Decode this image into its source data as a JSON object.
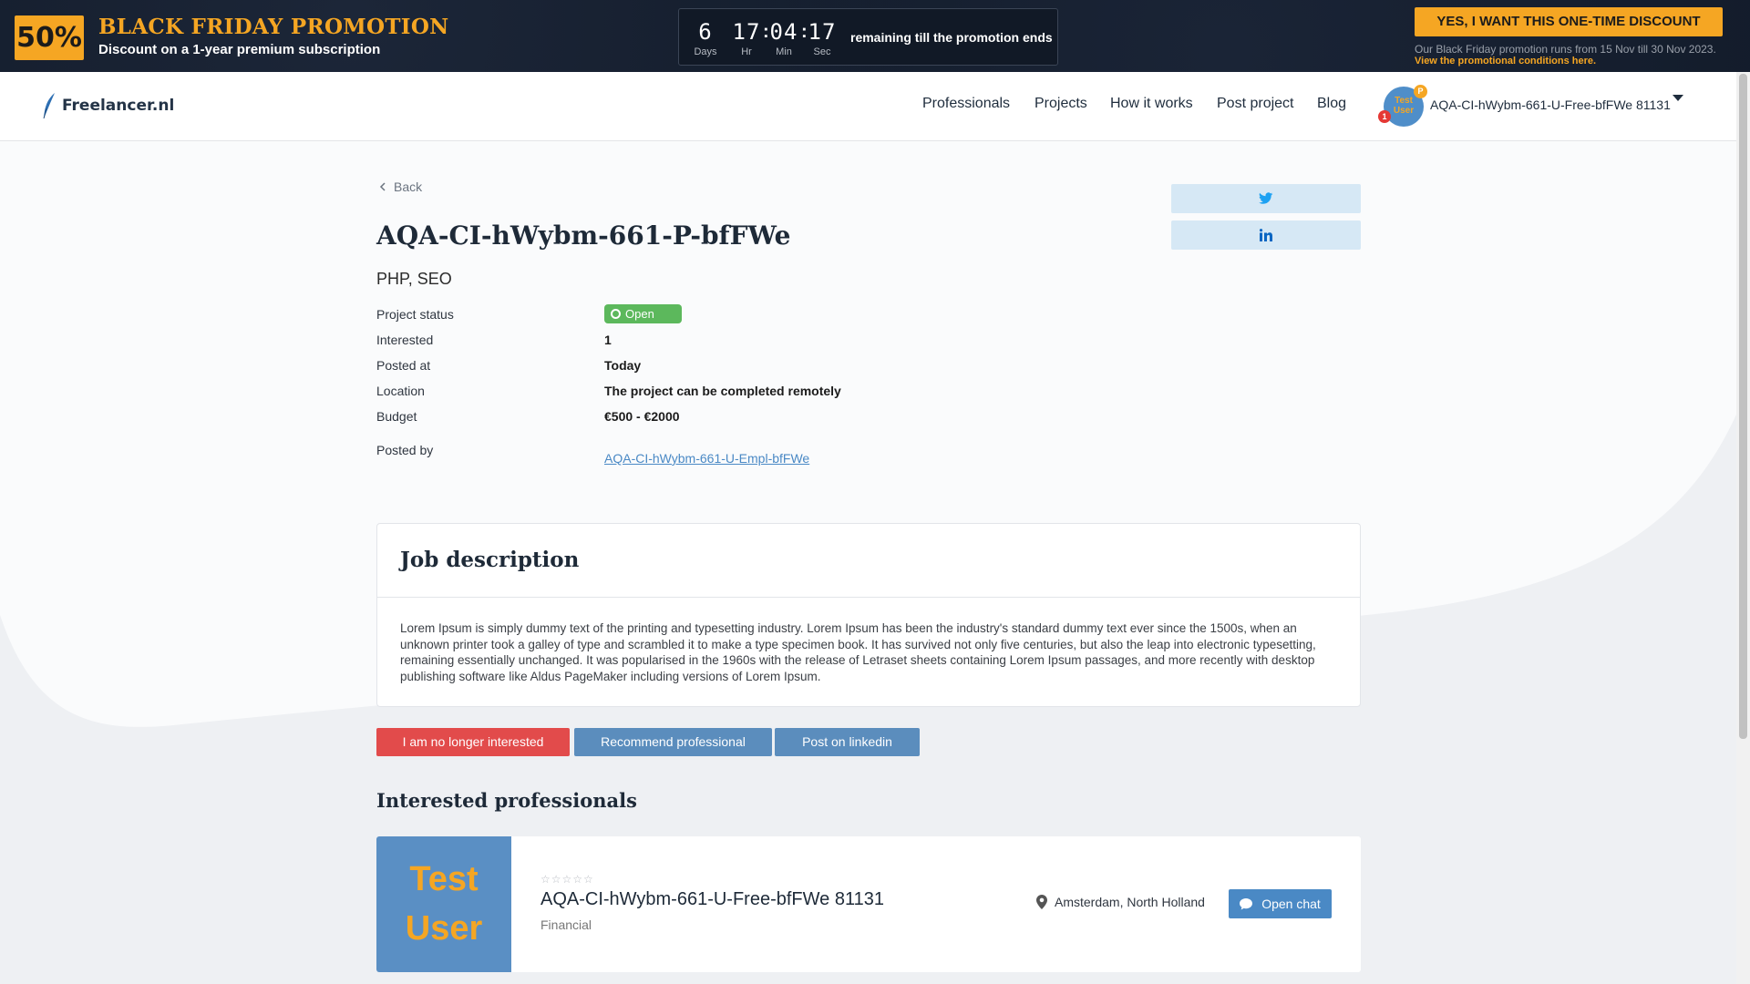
{
  "promo": {
    "badge": "50%",
    "title": "BLACK FRIDAY PROMOTION",
    "subtitle": "Discount on a 1-year premium subscription",
    "countdown": {
      "days": "6",
      "days_label": "Days",
      "hours": "17",
      "hours_label": "Hr",
      "minutes": "04",
      "minutes_label": "Min",
      "seconds": "17",
      "seconds_label": "Sec",
      "text": "remaining till the promotion ends"
    },
    "cta": "YES, I WANT THIS ONE-TIME DISCOUNT",
    "note": "Our Black Friday promotion runs from 15 Nov till 30 Nov 2023.",
    "link": "View the promotional conditions here."
  },
  "header": {
    "logo": "Freelancer.nl",
    "nav": [
      "Professionals",
      "Projects",
      "How it works",
      "Post project",
      "Blog"
    ],
    "user": {
      "avatar_text": "Test User",
      "badge_p": "P",
      "notification_count": "1",
      "name": "AQA-CI-hWybm-661-U-Free-bfFWe 81131"
    }
  },
  "project": {
    "back": "Back",
    "title": "AQA-CI-hWybm-661-P-bfFWe",
    "skills": "PHP, SEO",
    "details": {
      "status_label": "Project status",
      "status": "Open",
      "interested_label": "Interested",
      "interested": "1",
      "posted_at_label": "Posted at",
      "posted_at": "Today",
      "location_label": "Location",
      "location": "The project can be completed remotely",
      "budget_label": "Budget",
      "budget": "€500 - €2000",
      "posted_by_label": "Posted by",
      "posted_by": "AQA-CI-hWybm-661-U-Empl-bfFWe"
    }
  },
  "job": {
    "title": "Job description",
    "body": "Lorem Ipsum is simply dummy text of the printing and typesetting industry. Lorem Ipsum has been the industry's standard dummy text ever since the 1500s, when an unknown printer took a galley of type and scrambled it to make a type specimen book. It has survived not only five centuries, but also the leap into electronic typesetting, remaining essentially unchanged. It was popularised in the 1960s with the release of Letraset sheets containing Lorem Ipsum passages, and more recently with desktop publishing software like Aldus PageMaker including versions of Lorem Ipsum."
  },
  "actions": {
    "not_interested": "I am no longer interested",
    "recommend": "Recommend professional",
    "post_linkedin": "Post on linkedin"
  },
  "interested": {
    "title": "Interested professionals",
    "professional": {
      "image_text": "Test User",
      "rating": 0,
      "name": "AQA-CI-hWybm-661-U-Free-bfFWe 81131",
      "category": "Financial",
      "location": "Amsterdam, North Holland",
      "chat": "Open chat"
    }
  },
  "colors": {
    "accent": "#f5a623",
    "primary": "#4a89c5",
    "danger": "#e24b4b",
    "status_open": "#5cb85c",
    "promo_bg": "#131c2b"
  }
}
